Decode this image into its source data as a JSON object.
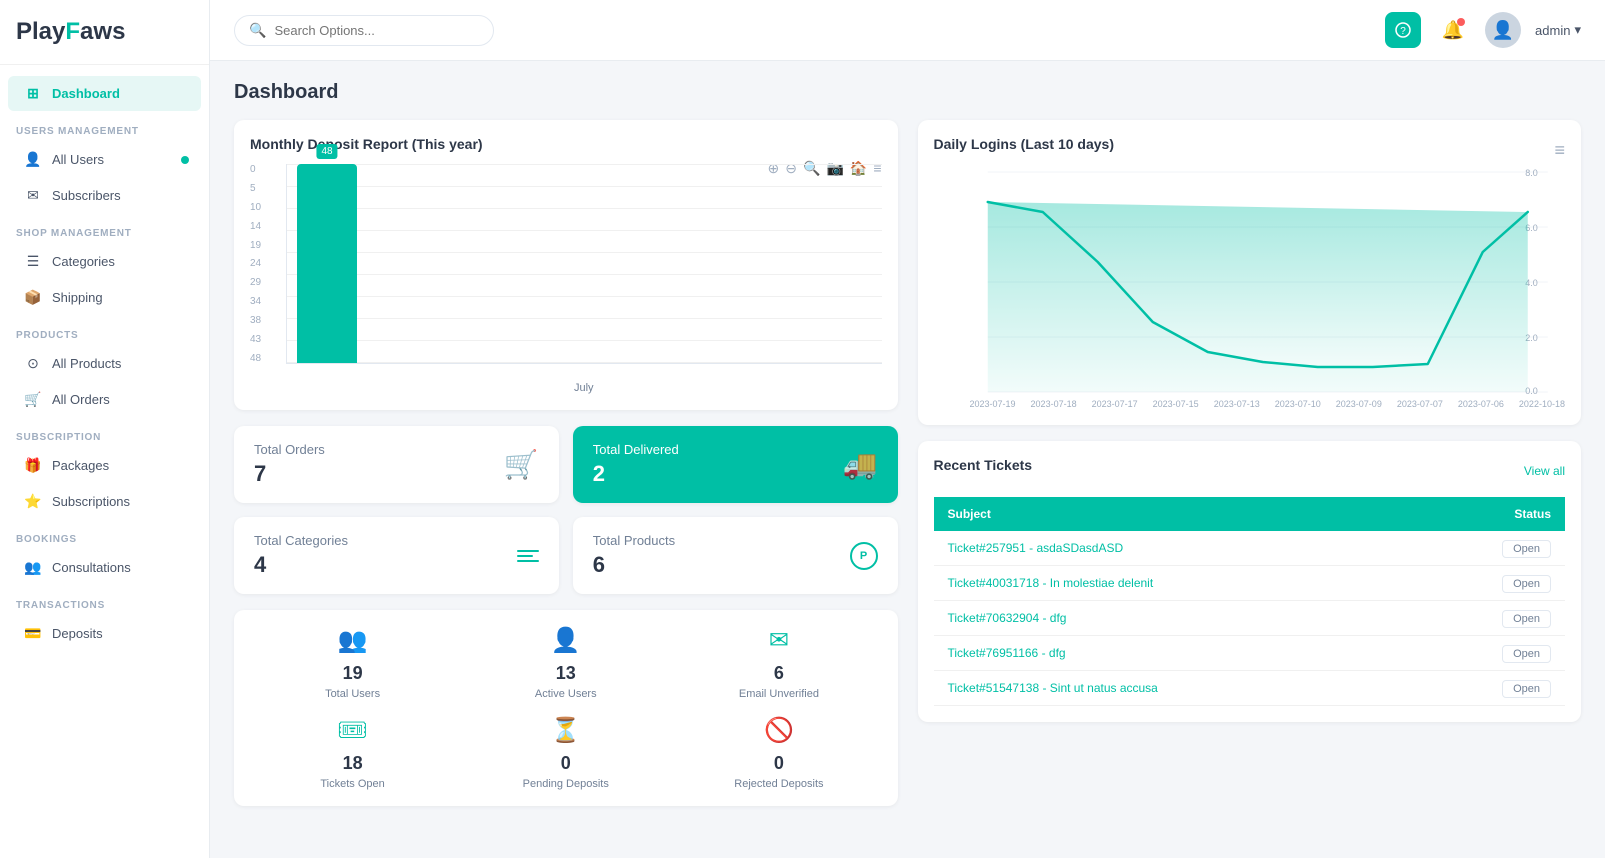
{
  "app": {
    "name": "PlayFaws",
    "logo_play": "Play",
    "logo_f": "F",
    "logo_aws": "aws"
  },
  "topbar": {
    "search_placeholder": "Search Options...",
    "admin_label": "admin"
  },
  "sidebar": {
    "sections": [
      {
        "label": "USERS MANAGEMENT",
        "items": [
          {
            "id": "all-users",
            "label": "All Users",
            "icon": "👤",
            "active": false,
            "dot": true
          },
          {
            "id": "subscribers",
            "label": "Subscribers",
            "icon": "✉",
            "active": false,
            "dot": false
          }
        ]
      },
      {
        "label": "SHOP MANAGEMENT",
        "items": [
          {
            "id": "categories",
            "label": "Categories",
            "icon": "☰",
            "active": false,
            "dot": false
          },
          {
            "id": "shipping",
            "label": "Shipping",
            "icon": "📦",
            "active": false,
            "dot": false
          }
        ]
      },
      {
        "label": "PRODUCTS",
        "items": [
          {
            "id": "all-products",
            "label": "All Products",
            "icon": "⊙",
            "active": false,
            "dot": false
          },
          {
            "id": "all-orders",
            "label": "All Orders",
            "icon": "🛒",
            "active": false,
            "dot": false
          }
        ]
      },
      {
        "label": "SUBSCRIPTION",
        "items": [
          {
            "id": "packages",
            "label": "Packages",
            "icon": "🎁",
            "active": false,
            "dot": false
          },
          {
            "id": "subscriptions",
            "label": "Subscriptions",
            "icon": "⭐",
            "active": false,
            "dot": false
          }
        ]
      },
      {
        "label": "BOOKINGS",
        "items": [
          {
            "id": "consultations",
            "label": "Consultations",
            "icon": "👥",
            "active": false,
            "dot": false
          }
        ]
      },
      {
        "label": "TRANSACTIONS",
        "items": [
          {
            "id": "deposits",
            "label": "Deposits",
            "icon": "💳",
            "active": false,
            "dot": false
          }
        ]
      }
    ],
    "dashboard_label": "Dashboard"
  },
  "page": {
    "title": "Dashboard"
  },
  "monthly_chart": {
    "title": "Monthly Deposit Report (This year)",
    "bar_label": "48",
    "x_label": "July",
    "y_values": [
      "0",
      "5",
      "10",
      "14",
      "19",
      "24",
      "29",
      "34",
      "38",
      "43",
      "48"
    ]
  },
  "daily_logins": {
    "title": "Daily Logins (Last 10 days)",
    "y_values": [
      "0.0",
      "2.0",
      "4.0",
      "6.0",
      "8.0"
    ],
    "x_dates": [
      "2023-07-19",
      "2023-07-18",
      "2023-07-17",
      "2023-07-15",
      "2023-07-13",
      "2023-07-10",
      "2023-07-09",
      "2023-07-07",
      "2023-07-06",
      "2022-10-18"
    ]
  },
  "stat_cards": [
    {
      "id": "total-orders",
      "label": "Total Orders",
      "value": "7",
      "icon": "🛒",
      "teal": false
    },
    {
      "id": "total-delivered",
      "label": "Total Delivered",
      "value": "2",
      "icon": "🚚",
      "teal": true
    },
    {
      "id": "total-categories",
      "label": "Total Categories",
      "value": "4",
      "icon": "≡",
      "teal": false
    },
    {
      "id": "total-products",
      "label": "Total Products",
      "value": "6",
      "icon": "P",
      "teal": false
    }
  ],
  "bottom_stats": [
    {
      "id": "total-users",
      "value": "19",
      "label": "Total Users",
      "icon": "👥"
    },
    {
      "id": "active-users",
      "value": "13",
      "label": "Active Users",
      "icon": "👤"
    },
    {
      "id": "email-unverified",
      "value": "6",
      "label": "Email Unverified",
      "icon": "✉"
    },
    {
      "id": "tickets-open",
      "value": "18",
      "label": "Tickets Open",
      "icon": "🎟"
    },
    {
      "id": "pending-deposits",
      "value": "0",
      "label": "Pending Deposits",
      "icon": "⏳"
    },
    {
      "id": "rejected-deposits",
      "value": "0",
      "label": "Rejected Deposits",
      "icon": "🚫"
    }
  ],
  "recent_tickets": {
    "title": "Recent Tickets",
    "view_all": "View all",
    "columns": [
      "Subject",
      "Status"
    ],
    "rows": [
      {
        "id": "ticket-257951",
        "subject": "Ticket#257951 - asdaSDasdASD",
        "status": "Open"
      },
      {
        "id": "ticket-40031718",
        "subject": "Ticket#40031718 - In molestiae delenit",
        "status": "Open"
      },
      {
        "id": "ticket-70632904",
        "subject": "Ticket#70632904 - dfg",
        "status": "Open"
      },
      {
        "id": "ticket-76951166",
        "subject": "Ticket#76951166 - dfg",
        "status": "Open"
      },
      {
        "id": "ticket-51547138",
        "subject": "Ticket#51547138 - Sint ut natus accusa",
        "status": "Open"
      }
    ]
  }
}
